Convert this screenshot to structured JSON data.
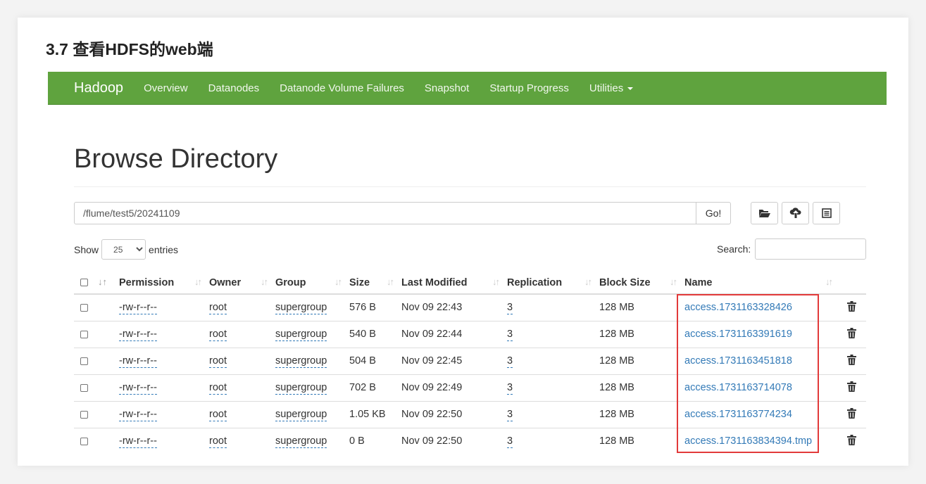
{
  "doc_heading": "3.7 查看HDFS的web端",
  "navbar": {
    "brand": "Hadoop",
    "items": [
      "Overview",
      "Datanodes",
      "Datanode Volume Failures",
      "Snapshot",
      "Startup Progress",
      "Utilities"
    ],
    "color": "#5fa33e"
  },
  "page_title": "Browse Directory",
  "path": {
    "value": "/flume/test5/20241109",
    "go_label": "Go!"
  },
  "toolbar_icons": [
    "folder-open-icon",
    "cloud-upload-icon",
    "list-icon"
  ],
  "entries": {
    "show_label": "Show",
    "selected": "25",
    "entries_label": "entries"
  },
  "search": {
    "label": "Search:"
  },
  "table": {
    "headers": [
      "Permission",
      "Owner",
      "Group",
      "Size",
      "Last Modified",
      "Replication",
      "Block Size",
      "Name"
    ],
    "rows": [
      {
        "permission": "-rw-r--r--",
        "owner": "root",
        "group": "supergroup",
        "size": "576 B",
        "modified": "Nov 09 22:43",
        "replication": "3",
        "block_size": "128 MB",
        "name": "access.1731163328426"
      },
      {
        "permission": "-rw-r--r--",
        "owner": "root",
        "group": "supergroup",
        "size": "540 B",
        "modified": "Nov 09 22:44",
        "replication": "3",
        "block_size": "128 MB",
        "name": "access.1731163391619"
      },
      {
        "permission": "-rw-r--r--",
        "owner": "root",
        "group": "supergroup",
        "size": "504 B",
        "modified": "Nov 09 22:45",
        "replication": "3",
        "block_size": "128 MB",
        "name": "access.1731163451818"
      },
      {
        "permission": "-rw-r--r--",
        "owner": "root",
        "group": "supergroup",
        "size": "702 B",
        "modified": "Nov 09 22:49",
        "replication": "3",
        "block_size": "128 MB",
        "name": "access.1731163714078"
      },
      {
        "permission": "-rw-r--r--",
        "owner": "root",
        "group": "supergroup",
        "size": "1.05 KB",
        "modified": "Nov 09 22:50",
        "replication": "3",
        "block_size": "128 MB",
        "name": "access.1731163774234"
      },
      {
        "permission": "-rw-r--r--",
        "owner": "root",
        "group": "supergroup",
        "size": "0 B",
        "modified": "Nov 09 22:50",
        "replication": "3",
        "block_size": "128 MB",
        "name": "access.1731163834394.tmp"
      }
    ]
  },
  "colors": {
    "link": "#337ab7",
    "highlight": "#e23a3a"
  }
}
